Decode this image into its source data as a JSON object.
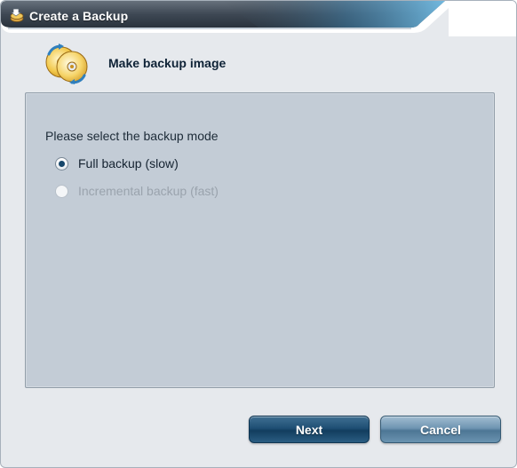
{
  "window": {
    "title": "Create a Backup"
  },
  "header": {
    "title": "Make backup image"
  },
  "panel": {
    "prompt": "Please select the backup mode",
    "options": [
      {
        "label": "Full backup (slow)",
        "selected": true,
        "enabled": true
      },
      {
        "label": "Incremental backup (fast)",
        "selected": false,
        "enabled": false
      }
    ]
  },
  "buttons": {
    "next_label": "Next",
    "cancel_label": "Cancel"
  },
  "colors": {
    "titlebar_dark": "#3c4651",
    "titlebar_accent": "#5fa8d3",
    "panel_bg": "#c3ccd6",
    "window_bg": "#e6e9ed",
    "button_dark": "#1f4f74",
    "button_light": "#6f95b2"
  },
  "icons": {
    "title": "backup-icon",
    "header": "backup-discs-icon"
  }
}
